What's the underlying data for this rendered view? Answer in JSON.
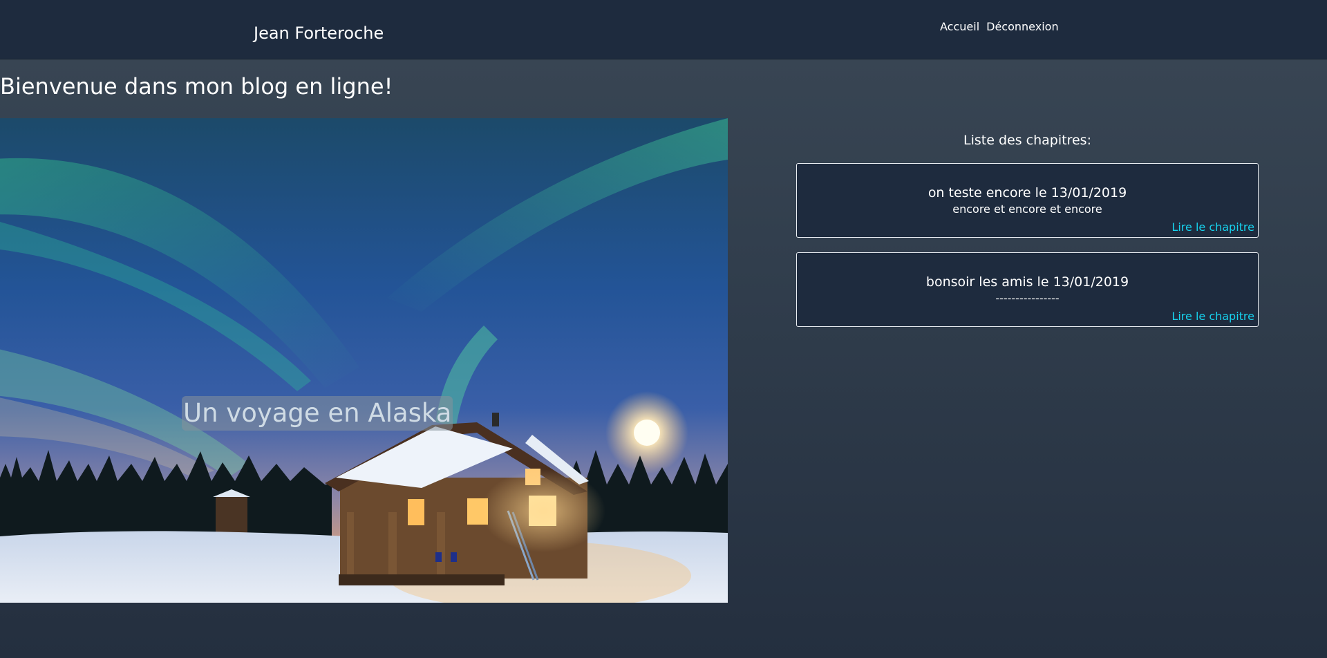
{
  "header": {
    "brand": "Jean Forteroche",
    "nav": [
      {
        "label": "Accueil"
      },
      {
        "label": "Déconnexion"
      }
    ]
  },
  "main": {
    "welcome_title": "Bienvenue dans mon blog en ligne!",
    "hero": {
      "caption": "Un voyage en Alaska"
    },
    "chapters": {
      "heading": "Liste des chapitres:",
      "items": [
        {
          "title": "on teste encore le 13/01/2019",
          "excerpt": "encore et encore et encore",
          "link": "Lire le chapitre"
        },
        {
          "title": "bonsoir les amis le 13/01/2019",
          "excerpt": "----------------",
          "link": "Lire le chapitre"
        }
      ]
    }
  },
  "colors": {
    "navbar": "#1e2b3e",
    "card": "#1e2b3e",
    "link_accent": "#17d3ee"
  }
}
